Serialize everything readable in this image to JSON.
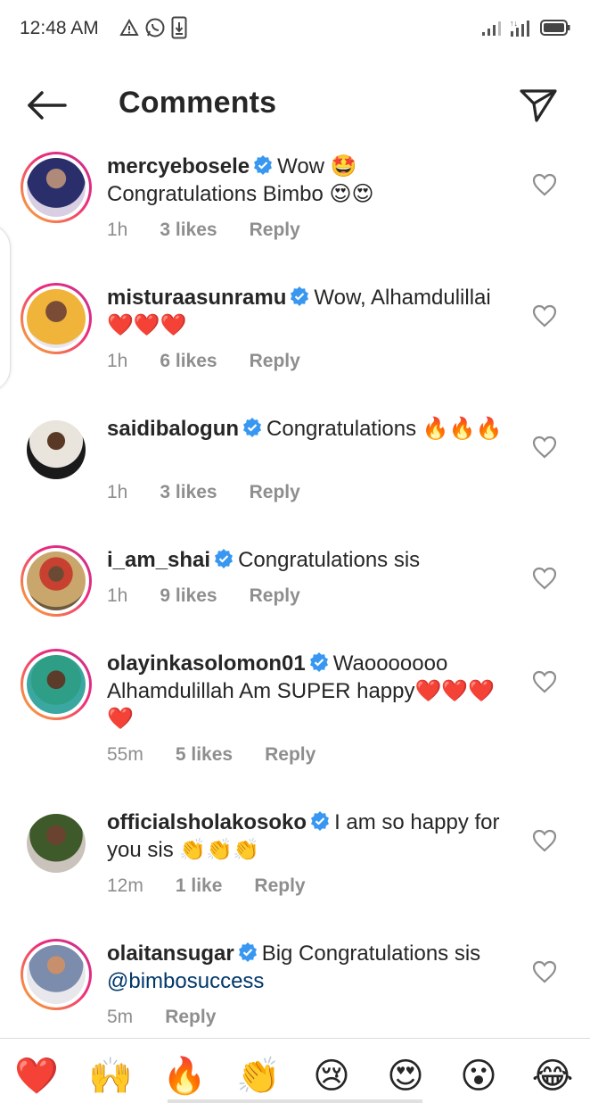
{
  "status_bar": {
    "time": "12:48 AM"
  },
  "header": {
    "title": "Comments"
  },
  "comments": [
    {
      "username": "mercyebosele",
      "text": "Wow 🤩 Congratulations Bimbo 😍😍",
      "time": "1h",
      "likes": "3 likes",
      "reply": "Reply"
    },
    {
      "username": "misturaasunramu",
      "text": "Wow, Alhamdulillai ❤️❤️❤️",
      "time": "1h",
      "likes": "6 likes",
      "reply": "Reply"
    },
    {
      "username": "saidibalogun",
      "text": "Congratulations 🔥🔥🔥",
      "time": "1h",
      "likes": "3 likes",
      "reply": "Reply"
    },
    {
      "username": "i_am_shai",
      "text": "Congratulations sis",
      "time": "1h",
      "likes": "9 likes",
      "reply": "Reply"
    },
    {
      "username": "olayinkasolomon01",
      "text": "Waooooooo Alhamdulillah Am SUPER happy❤️❤️❤️❤️",
      "time": "55m",
      "likes": "5 likes",
      "reply": "Reply"
    },
    {
      "username": "officialsholakosoko",
      "text": "I am so happy for you sis 👏👏👏",
      "time": "12m",
      "likes": "1 like",
      "reply": "Reply"
    },
    {
      "username": "olaitansugar",
      "text": "Big Congratulations sis",
      "mention": "@bimbosuccess",
      "time": "5m",
      "reply": "Reply"
    }
  ],
  "emoji_bar": [
    "❤️",
    "🙌",
    "🔥",
    "👏",
    "😢",
    "😍",
    "😮",
    "😂"
  ],
  "colors": {
    "text": "#262626",
    "meta": "#8e8e8e",
    "verified": "#3897f0",
    "mention": "#00376b",
    "story_ring": "#ee2a7b"
  },
  "icons": [
    "back-arrow-icon",
    "send-icon",
    "verified-icon",
    "heart-outline-icon"
  ]
}
